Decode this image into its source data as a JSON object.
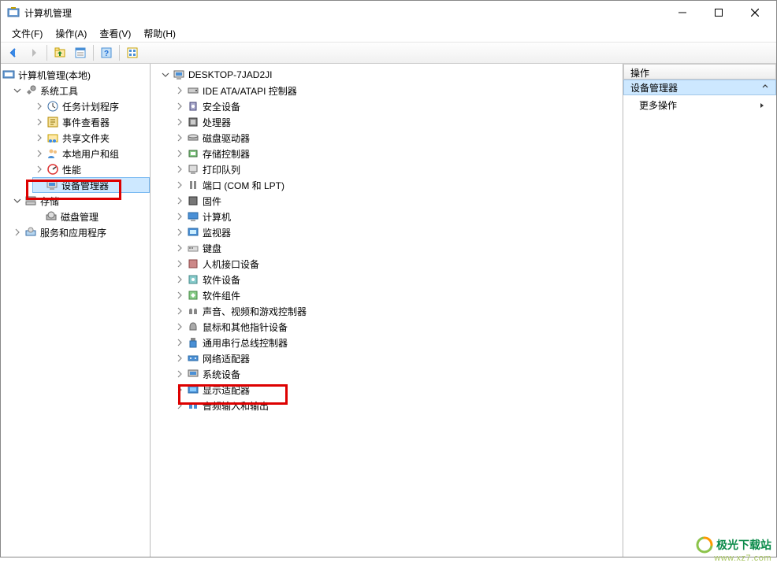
{
  "window": {
    "title": "计算机管理"
  },
  "menu": {
    "file": "文件(F)",
    "action": "操作(A)",
    "view": "查看(V)",
    "help": "帮助(H)"
  },
  "left_tree": {
    "root": "计算机管理(本地)",
    "system_tools": "系统工具",
    "task_scheduler": "任务计划程序",
    "event_viewer": "事件查看器",
    "shared_folders": "共享文件夹",
    "local_users": "本地用户和组",
    "performance": "性能",
    "device_manager": "设备管理器",
    "storage": "存储",
    "disk_mgmt": "磁盘管理",
    "services_apps": "服务和应用程序"
  },
  "center_tree": {
    "root": "DESKTOP-7JAD2JI",
    "items": [
      "IDE ATA/ATAPI 控制器",
      "安全设备",
      "处理器",
      "磁盘驱动器",
      "存储控制器",
      "打印队列",
      "端口 (COM 和 LPT)",
      "固件",
      "计算机",
      "监视器",
      "键盘",
      "人机接口设备",
      "软件设备",
      "软件组件",
      "声音、视频和游戏控制器",
      "鼠标和其他指针设备",
      "通用串行总线控制器",
      "网络适配器",
      "系统设备",
      "显示适配器",
      "音频输入和输出"
    ]
  },
  "right_pane": {
    "header": "操作",
    "group": "设备管理器",
    "more": "更多操作"
  },
  "watermark": {
    "main": "极光下载站",
    "sub": "www.xz7.com"
  }
}
